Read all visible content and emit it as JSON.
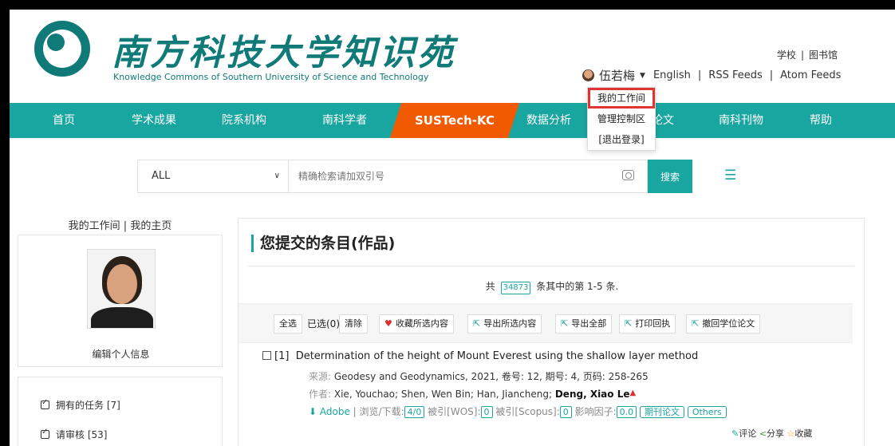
{
  "header": {
    "logo_title": "南方科技大学知识苑",
    "logo_subtitle": "Knowledge Commons of Southern University of Science and Technology",
    "top_links": [
      "学校",
      "图书馆"
    ],
    "user_name": "伍若梅",
    "user_links": [
      "English",
      "RSS Feeds",
      "Atom Feeds"
    ]
  },
  "nav": {
    "items": [
      "首页",
      "学术成果",
      "院系机构",
      "南科学者",
      "SUSTech-KC",
      "数据分析",
      "论文",
      "南科刊物",
      "帮助"
    ],
    "active": "SUSTech-KC"
  },
  "user_menu": {
    "items": [
      "我的工作间",
      "管理控制区",
      "[退出登录]"
    ],
    "highlighted": "我的工作间"
  },
  "search": {
    "scope": "ALL",
    "placeholder": "精确检索请加双引号",
    "button": "搜索"
  },
  "left": {
    "title": "我的工作间 | 我的主页",
    "edit_profile": "编辑个人信息",
    "tasks": [
      "拥有的任务 [7]",
      "请审核 [53]"
    ]
  },
  "main": {
    "title": "您提交的条目(作品)",
    "count_prefix": "共",
    "count_total": "34873",
    "count_suffix": "条其中的第 1-5 条.",
    "toolbar": {
      "select_all": "全选",
      "selected": "已选(0)",
      "clear": "清除",
      "favorite": "收藏所选内容",
      "export_selected": "导出所选内容",
      "export_all": "导出全部",
      "print": "打印回执",
      "withdraw": "撤回学位论文"
    },
    "records": [
      {
        "index": "[1]",
        "title": "Determination of the height of Mount Everest using the shallow layer method",
        "source_label": "来源:",
        "source": "Geodesy and Geodynamics, 2021, 卷号: 12, 期号: 4, 页码: 258-265",
        "authors_label": "作者:",
        "authors_plain": "Xie, Youchao;  Shen, Wen Bin;  Han, Jiancheng;",
        "authors_bold": "Deng, Xiao Le",
        "download": "Adobe",
        "views_label": "浏览/下载:",
        "views": "4/0",
        "wos_label": "被引[WOS]:",
        "wos": "0",
        "scopus_label": "被引[Scopus]:",
        "scopus": "0",
        "if_label": "影响因子:",
        "if": "0.0",
        "tags": [
          "期刊论文",
          "Others"
        ],
        "actions": [
          "评论",
          "分享",
          "收藏"
        ]
      }
    ]
  }
}
